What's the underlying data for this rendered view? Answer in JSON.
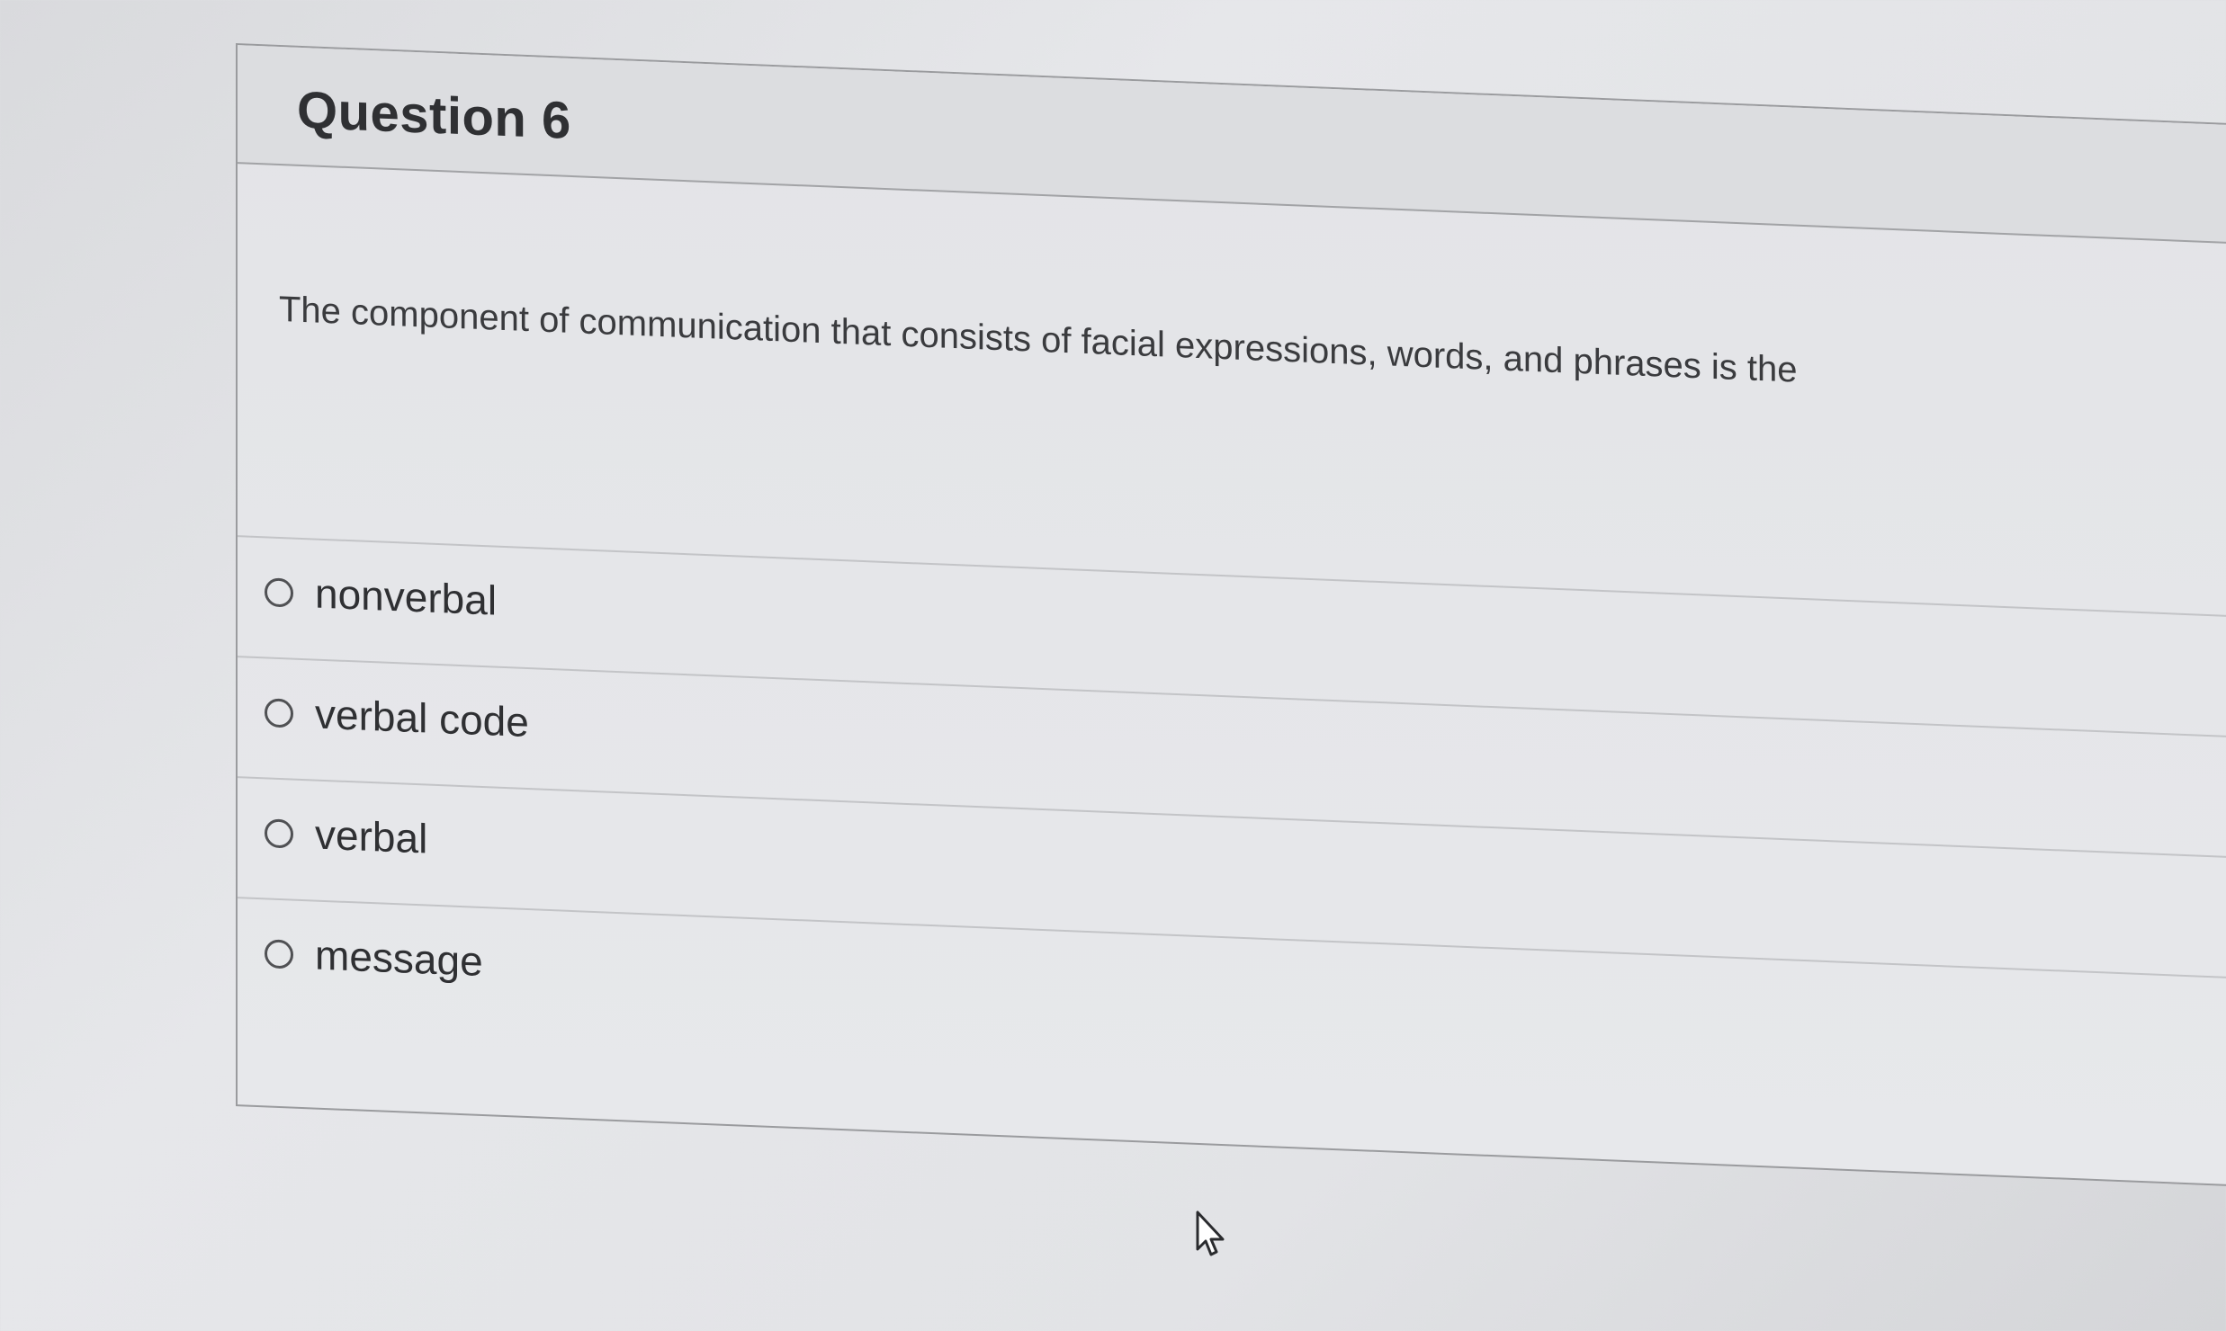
{
  "question": {
    "title": "Question 6",
    "text": "The component of communication that consists of facial expressions, words, and phrases is the"
  },
  "options": [
    {
      "label": "nonverbal",
      "selected": false
    },
    {
      "label": "verbal code",
      "selected": false
    },
    {
      "label": "verbal",
      "selected": false
    },
    {
      "label": "message",
      "selected": false
    }
  ],
  "icons": {
    "cursor": "mouse-pointer-icon",
    "radio": "radio-unchecked-icon"
  },
  "colors": {
    "text": "#2f3033",
    "border": "#9a9b9e",
    "background": "#e3e4e7"
  }
}
